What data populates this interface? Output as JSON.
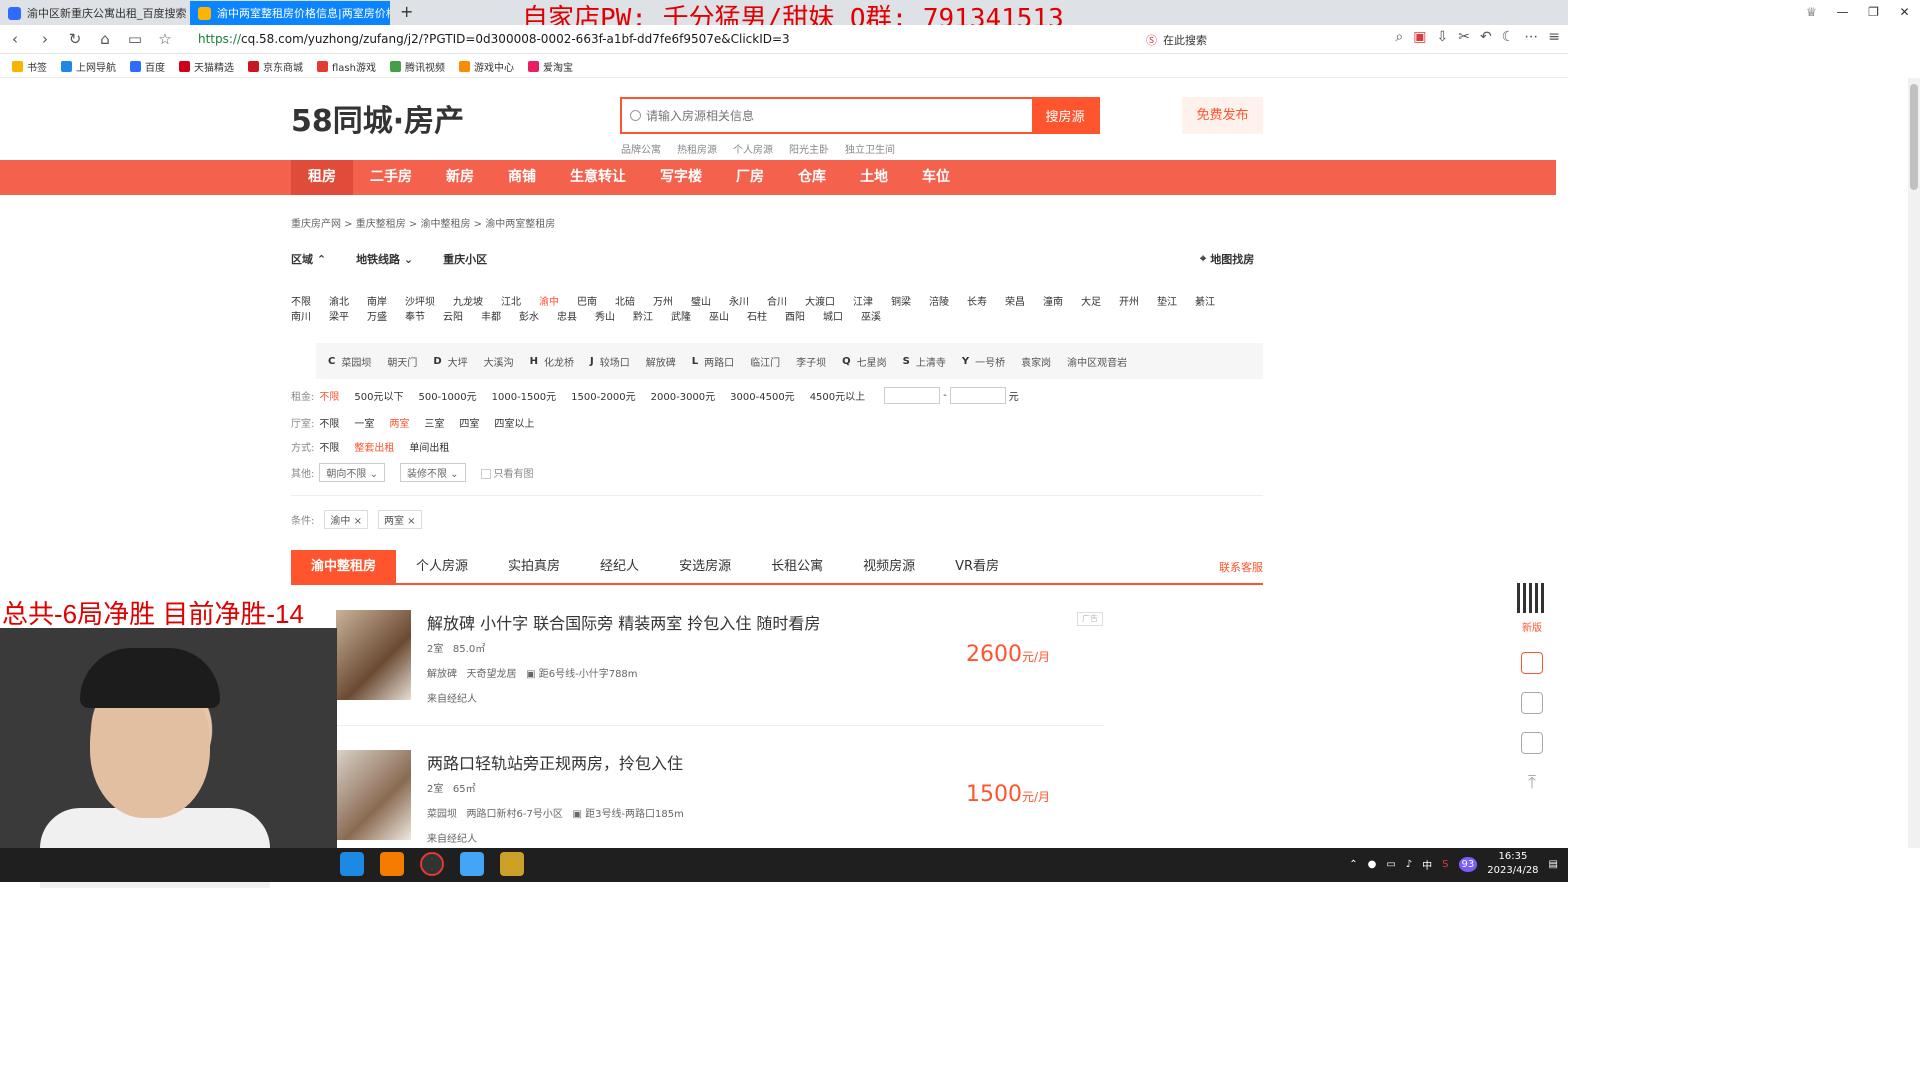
{
  "browser": {
    "tabs": [
      {
        "title": "渝中区新重庆公寓出租_百度搜索"
      },
      {
        "title": "渝中两室整租房价格信息|两室房价格"
      }
    ],
    "url": "https://cq.58.com/yuzhong/zufang/j2/?PGTID=0d300008-0002-663f-a1bf-dd7fe6f9507e&ClickID=3",
    "search_placeholder": "在此搜索",
    "bookmarks": [
      "书签",
      "上网导航",
      "百度",
      "天猫精选",
      "京东商城",
      "flash游戏",
      "腾讯视频",
      "游戏中心",
      "爱淘宝"
    ]
  },
  "overlay": {
    "top_text": "自家店PW: 千分猛男/甜妹 Q群: 791341513",
    "stream_text": "总共-6局净胜  目前净胜-14"
  },
  "site": {
    "logo": "58同城·房产",
    "search_placeholder": "请输入房源相关信息",
    "search_button": "搜房源",
    "publish_button": "免费发布",
    "hot_tags": [
      "品牌公寓",
      "热租房源",
      "个人房源",
      "阳光主卧",
      "独立卫生间"
    ],
    "nav": [
      "租房",
      "二手房",
      "新房",
      "商铺",
      "生意转让",
      "写字楼",
      "厂房",
      "仓库",
      "土地",
      "车位"
    ],
    "breadcrumb": "重庆房产网 > 重庆整租房 > 渝中整租房 > 渝中两室整租房",
    "filter_tabs": [
      "区域",
      "地铁线路",
      "重庆小区"
    ],
    "map_find": "地图找房",
    "districts": [
      "不限",
      "渝北",
      "南岸",
      "沙坪坝",
      "九龙坡",
      "江北",
      "渝中",
      "巴南",
      "北碚",
      "万州",
      "璧山",
      "永川",
      "合川",
      "大渡口",
      "江津",
      "铜梁",
      "涪陵",
      "长寿",
      "荣昌",
      "潼南",
      "大足",
      "开州",
      "垫江",
      "綦江",
      "南川",
      "梁平",
      "万盛",
      "奉节",
      "云阳",
      "丰都",
      "彭水",
      "忠县",
      "秀山",
      "黔江",
      "武隆",
      "巫山",
      "石柱",
      "酉阳",
      "城口",
      "巫溪"
    ],
    "subareas": [
      {
        "letter": "C",
        "name": "菜园坝"
      },
      {
        "letter": "",
        "name": "朝天门"
      },
      {
        "letter": "D",
        "name": "大坪"
      },
      {
        "letter": "",
        "name": "大溪沟"
      },
      {
        "letter": "H",
        "name": "化龙桥"
      },
      {
        "letter": "J",
        "name": "较场口"
      },
      {
        "letter": "",
        "name": "解放碑"
      },
      {
        "letter": "L",
        "name": "两路口"
      },
      {
        "letter": "",
        "name": "临江门"
      },
      {
        "letter": "",
        "name": "李子坝"
      },
      {
        "letter": "Q",
        "name": "七星岗"
      },
      {
        "letter": "S",
        "name": "上清寺"
      },
      {
        "letter": "Y",
        "name": "一号桥"
      },
      {
        "letter": "",
        "name": "袁家岗"
      },
      {
        "letter": "",
        "name": "渝中区观音岩"
      }
    ],
    "rent": {
      "label": "租金:",
      "options": [
        "不限",
        "500元以下",
        "500-1000元",
        "1000-1500元",
        "1500-2000元",
        "2000-3000元",
        "3000-4500元",
        "4500元以上"
      ],
      "unit": "元"
    },
    "rooms": {
      "label": "厅室:",
      "options": [
        "不限",
        "一室",
        "两室",
        "三室",
        "四室",
        "四室以上"
      ]
    },
    "mode": {
      "label": "方式:",
      "options": [
        "不限",
        "整套出租",
        "单间出租"
      ]
    },
    "other": {
      "label": "其他:",
      "orientation": "朝向不限",
      "decoration": "装修不限",
      "with_image": "只看有图"
    },
    "conditions": {
      "label": "条件:",
      "tags": [
        "渝中",
        "两室"
      ]
    },
    "list_tabs": [
      "渝中整租房",
      "个人房源",
      "实拍真房",
      "经纪人",
      "安选房源",
      "长租公寓",
      "视频房源",
      "VR看房"
    ],
    "customer_service": "联系客服",
    "listings": [
      {
        "title": "解放碑 小什字 联合国际旁 精装两室 拎包入住 随时看房",
        "rooms": "2室",
        "area": "85.0㎡",
        "location": "解放碑",
        "community": "天奇望龙居",
        "metro": "距6号线-小什字788m",
        "source": "来自经纪人",
        "price": "2600",
        "unit": "元/月"
      },
      {
        "title": "两路口轻轨站旁正规两房，拎包入住",
        "rooms": "2室",
        "area": "65㎡",
        "location": "菜园坝",
        "community": "两路口新村6-7号小区",
        "metro": "距3号线-两路口185m",
        "source": "来自经纪人",
        "price": "1500",
        "unit": "元/月"
      }
    ],
    "ad_label": "广告",
    "side_new": "新版"
  },
  "taskbar": {
    "time": "16:35",
    "date": "2023/4/28",
    "ime": "中",
    "badge": "93"
  }
}
